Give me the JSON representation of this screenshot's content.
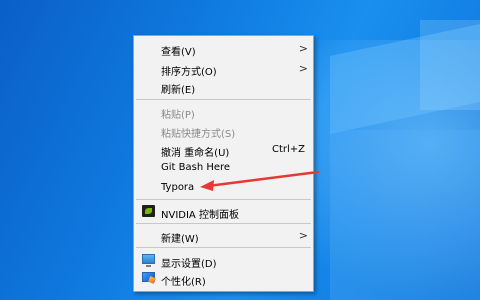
{
  "context_menu": {
    "items": [
      {
        "label": "查看(V)",
        "submenu": true
      },
      {
        "label": "排序方式(O)",
        "submenu": true
      },
      {
        "label": "刷新(E)"
      },
      {
        "label": "粘贴(P)",
        "disabled": true
      },
      {
        "label": "粘贴快捷方式(S)",
        "disabled": true
      },
      {
        "label": "撤消 重命名(U)",
        "shortcut": "Ctrl+Z"
      },
      {
        "label": "Git Bash Here"
      },
      {
        "label": "Typora"
      },
      {
        "label": "NVIDIA 控制面板",
        "icon": "nvidia-icon"
      },
      {
        "label": "新建(W)",
        "submenu": true
      },
      {
        "label": "显示设置(D)",
        "icon": "display-settings-icon"
      },
      {
        "label": "个性化(R)",
        "icon": "personalize-icon"
      }
    ]
  },
  "annotation": {
    "color": "#e53935",
    "points_to": "Typora"
  }
}
